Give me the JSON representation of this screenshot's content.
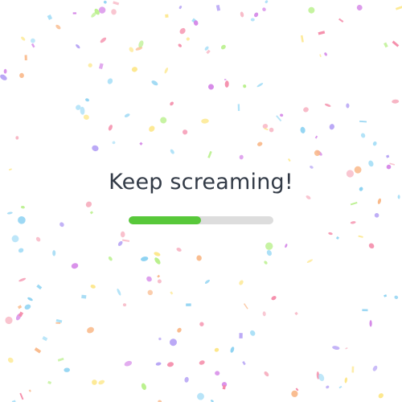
{
  "message": "Keep screaming!",
  "progress": {
    "fraction": 0.5,
    "fill_color": "#58c83a",
    "track_color": "#dddddd"
  },
  "confetti_colors": [
    "#b7a4f5",
    "#f7b3c2",
    "#a9dff7",
    "#fde78a",
    "#b8f08a",
    "#f9b98a",
    "#d68ae8",
    "#8fd3f2",
    "#f48aa8"
  ]
}
